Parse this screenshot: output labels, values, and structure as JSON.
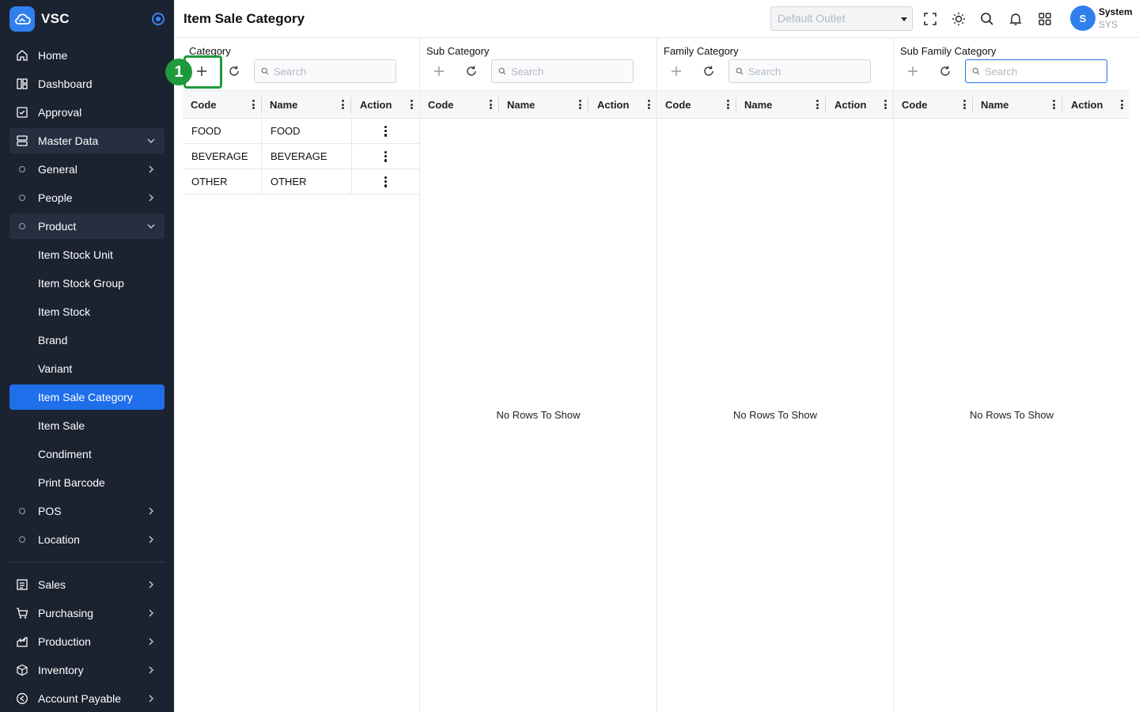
{
  "app": {
    "name": "VSC"
  },
  "sidebar": {
    "top_items": [
      {
        "label": "Home",
        "icon": "home-icon"
      },
      {
        "label": "Dashboard",
        "icon": "dashboard-icon"
      },
      {
        "label": "Approval",
        "icon": "approval-icon"
      },
      {
        "label": "Master Data",
        "icon": "database-icon",
        "expanded": true
      }
    ],
    "master_data_children": [
      {
        "label": "General",
        "has_children": true
      },
      {
        "label": "People",
        "has_children": true
      },
      {
        "label": "Product",
        "has_children": true,
        "expanded": true
      }
    ],
    "product_children": [
      {
        "label": "Item Stock Unit"
      },
      {
        "label": "Item Stock Group"
      },
      {
        "label": "Item Stock"
      },
      {
        "label": "Brand"
      },
      {
        "label": "Variant"
      },
      {
        "label": "Item Sale Category",
        "active": true
      },
      {
        "label": "Item Sale"
      },
      {
        "label": "Condiment"
      },
      {
        "label": "Print Barcode"
      }
    ],
    "more_children": [
      {
        "label": "POS",
        "has_children": true
      },
      {
        "label": "Location",
        "has_children": true
      }
    ],
    "bottom_items": [
      {
        "label": "Sales",
        "icon": "sales-icon"
      },
      {
        "label": "Purchasing",
        "icon": "cart-icon"
      },
      {
        "label": "Production",
        "icon": "factory-icon"
      },
      {
        "label": "Inventory",
        "icon": "box-icon"
      },
      {
        "label": "Account Payable",
        "icon": "payable-icon"
      }
    ]
  },
  "header": {
    "title": "Item Sale Category",
    "outlet_placeholder": "Default Outlet",
    "user": {
      "initial": "S",
      "name": "System",
      "code": "SYS"
    }
  },
  "panels": [
    {
      "title": "Category",
      "search_placeholder": "Search",
      "columns": [
        "Code",
        "Name",
        "Action"
      ],
      "rows": [
        {
          "code": "FOOD",
          "name": "FOOD"
        },
        {
          "code": "BEVERAGE",
          "name": "BEVERAGE"
        },
        {
          "code": "OTHER",
          "name": "OTHER"
        }
      ],
      "empty_text": ""
    },
    {
      "title": "Sub Category",
      "search_placeholder": "Search",
      "columns": [
        "Code",
        "Name",
        "Action"
      ],
      "rows": [],
      "empty_text": "No Rows To Show"
    },
    {
      "title": "Family Category",
      "search_placeholder": "Search",
      "columns": [
        "Code",
        "Name",
        "Action"
      ],
      "rows": [],
      "empty_text": "No Rows To Show"
    },
    {
      "title": "Sub Family Category",
      "search_placeholder": "Search",
      "columns": [
        "Code",
        "Name",
        "Action"
      ],
      "rows": [],
      "empty_text": "No Rows To Show"
    }
  ],
  "annotation": {
    "number": "1"
  },
  "colors": {
    "sidebar_bg": "#1b2230",
    "active": "#1f6feb",
    "annotation": "#1e9a3e"
  }
}
